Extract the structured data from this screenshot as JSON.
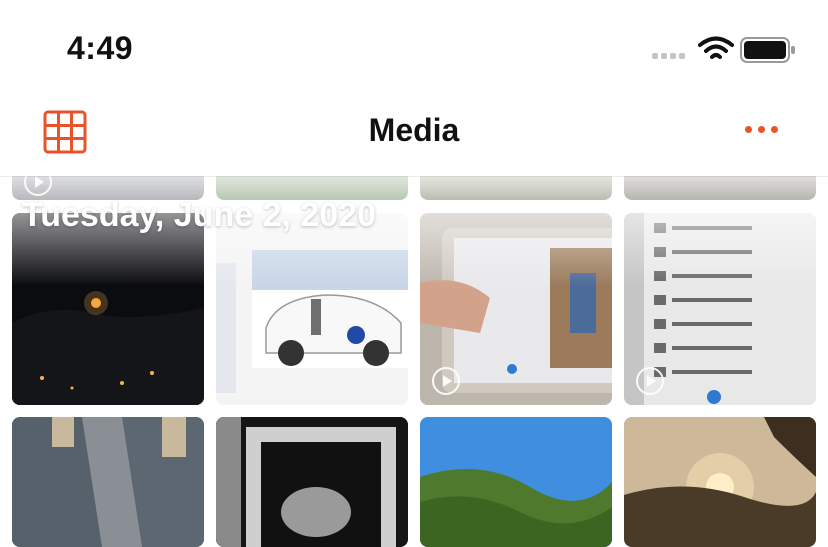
{
  "status": {
    "time": "4:49"
  },
  "nav": {
    "title": "Media"
  },
  "section": {
    "date": "Tuesday, June 2, 2020"
  },
  "icons": {
    "grid": "grid-icon",
    "more": "more-icon",
    "wifi": "wifi-icon",
    "battery": "battery-icon",
    "signal": "signal-icon",
    "play": "play-icon"
  },
  "colors": {
    "accent": "#e8532a"
  }
}
